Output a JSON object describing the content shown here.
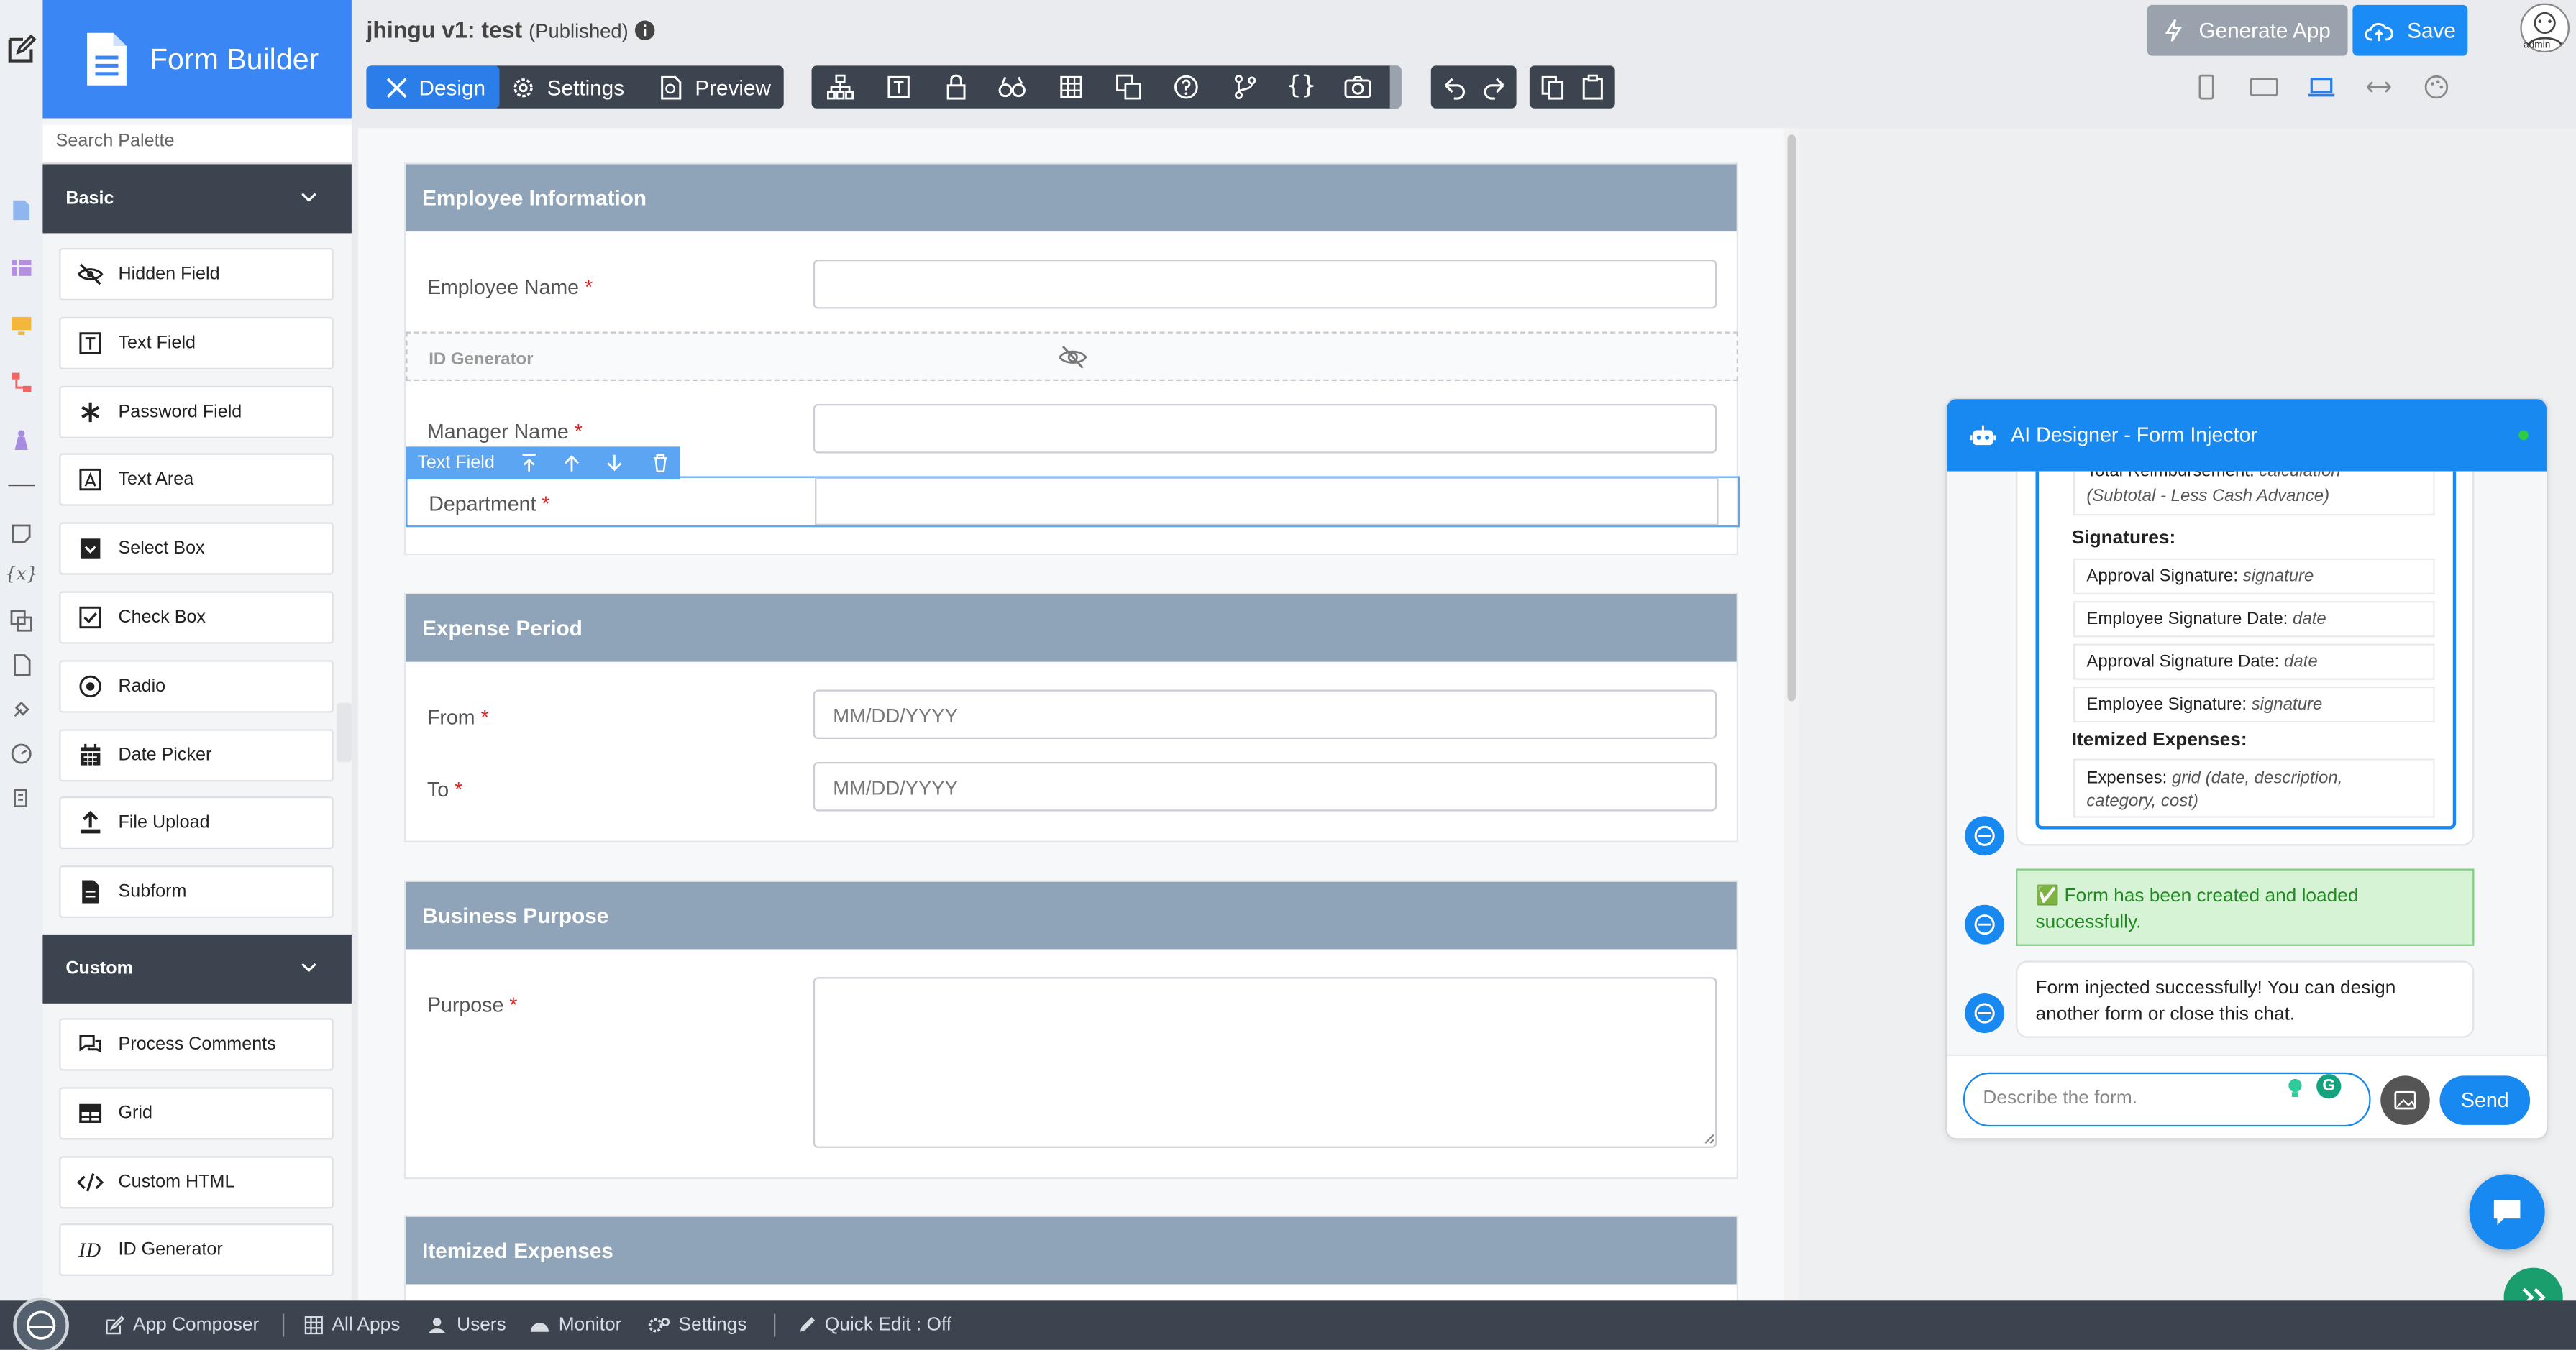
{
  "app": {
    "brand": "Form Builder",
    "title": "jhingu v1: test",
    "status": "(Published)",
    "avatar_label": "admin"
  },
  "palette": {
    "search_placeholder": "Search Palette",
    "basic_header": "Basic",
    "basic_items": [
      {
        "label": "Hidden Field",
        "icon": "eye-slash-icon"
      },
      {
        "label": "Text Field",
        "icon": "text-field-icon"
      },
      {
        "label": "Password Field",
        "icon": "asterisk-icon"
      },
      {
        "label": "Text Area",
        "icon": "text-area-icon"
      },
      {
        "label": "Select Box",
        "icon": "select-box-icon"
      },
      {
        "label": "Check Box",
        "icon": "checkbox-icon"
      },
      {
        "label": "Radio",
        "icon": "radio-icon"
      },
      {
        "label": "Date Picker",
        "icon": "calendar-icon"
      },
      {
        "label": "File Upload",
        "icon": "upload-icon"
      },
      {
        "label": "Subform",
        "icon": "file-icon"
      }
    ],
    "custom_header": "Custom",
    "custom_items": [
      {
        "label": "Process Comments",
        "icon": "comments-icon"
      },
      {
        "label": "Grid",
        "icon": "grid-icon"
      },
      {
        "label": "Custom HTML",
        "icon": "code-icon"
      },
      {
        "label": "ID Generator",
        "icon": "id-icon"
      }
    ]
  },
  "toolbar": {
    "design": "Design",
    "settings": "Settings",
    "preview": "Preview",
    "generate": "Generate App",
    "save": "Save"
  },
  "form": {
    "sections": [
      {
        "title": "Employee Information",
        "fields": [
          {
            "label": "Employee Name",
            "required": "*",
            "placeholder": ""
          },
          {
            "label": "ID Generator",
            "hidden": true
          },
          {
            "label": "Manager Name",
            "required": "*",
            "placeholder": ""
          },
          {
            "label": "Department",
            "required": "*",
            "placeholder": "",
            "selected": true
          }
        ]
      },
      {
        "title": "Expense Period",
        "fields": [
          {
            "label": "From",
            "required": "*",
            "placeholder": "MM/DD/YYYY"
          },
          {
            "label": "To",
            "required": "*",
            "placeholder": "MM/DD/YYYY"
          }
        ]
      },
      {
        "title": "Business Purpose",
        "fields": [
          {
            "label": "Purpose",
            "required": "*",
            "placeholder": ""
          }
        ]
      },
      {
        "title": "Itemized Expenses",
        "fields": []
      }
    ],
    "selected_tag": "Text Field"
  },
  "chat": {
    "title": "AI Designer - Form Injector",
    "summary_partial": {
      "label": "Total Reimbursement:",
      "type": "calculation"
    },
    "summary_partial_note": "(Subtotal - Less Cash Advance)",
    "signatures_header": "Signatures:",
    "signatures": [
      {
        "label": "Approval Signature:",
        "type": "signature"
      },
      {
        "label": "Employee Signature Date:",
        "type": "date"
      },
      {
        "label": "Approval Signature Date:",
        "type": "date"
      },
      {
        "label": "Employee Signature:",
        "type": "signature"
      }
    ],
    "itemized_header": "Itemized Expenses:",
    "itemized": {
      "label": "Expenses:",
      "type": "grid (date, description,",
      "type2": "category, cost)"
    },
    "success_icon": "✅",
    "success_msg": "Form has been created and loaded successfully.",
    "injected_msg": "Form injected successfully! You can design another form or close this chat.",
    "input_placeholder": "Describe the form.",
    "send": "Send"
  },
  "bottombar": {
    "app_composer": "App Composer",
    "all_apps": "All Apps",
    "users": "Users",
    "monitor": "Monitor",
    "settings": "Settings",
    "quick_edit": "Quick Edit : Off"
  },
  "colors": {
    "accent": "#3a86f5",
    "section_header": "#8fa4b8",
    "dark": "#3c4450",
    "success": "#1f8a1f"
  }
}
